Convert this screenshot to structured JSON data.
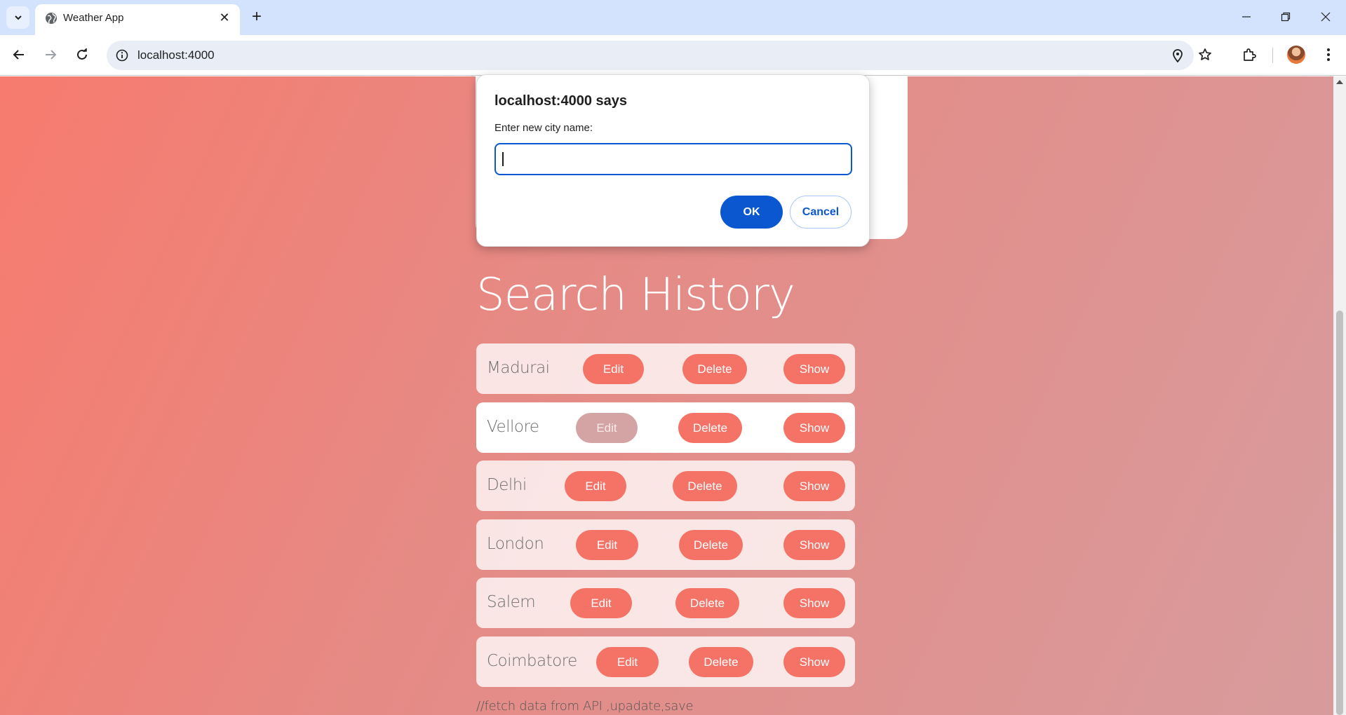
{
  "browser": {
    "tab_title": "Weather App",
    "url": "localhost:4000"
  },
  "dialog": {
    "title": "localhost:4000 says",
    "message": "Enter new city name:",
    "input_value": "",
    "ok_label": "OK",
    "cancel_label": "Cancel"
  },
  "history": {
    "title": "Search History",
    "rows": [
      {
        "city": "Madurai",
        "edit": "Edit",
        "delete": "Delete",
        "show": "Show"
      },
      {
        "city": "Vellore",
        "edit": "Edit",
        "delete": "Delete",
        "show": "Show"
      },
      {
        "city": "Delhi",
        "edit": "Edit",
        "delete": "Delete",
        "show": "Show"
      },
      {
        "city": "London",
        "edit": "Edit",
        "delete": "Delete",
        "show": "Show"
      },
      {
        "city": "Salem",
        "edit": "Edit",
        "delete": "Delete",
        "show": "Show"
      },
      {
        "city": "Coimbatore",
        "edit": "Edit",
        "delete": "Delete",
        "show": "Show"
      }
    ]
  },
  "footnote": "//fetch data from API ,upadate,save",
  "colors": {
    "accent": "#f47266",
    "dialog_primary": "#0b57d0"
  }
}
